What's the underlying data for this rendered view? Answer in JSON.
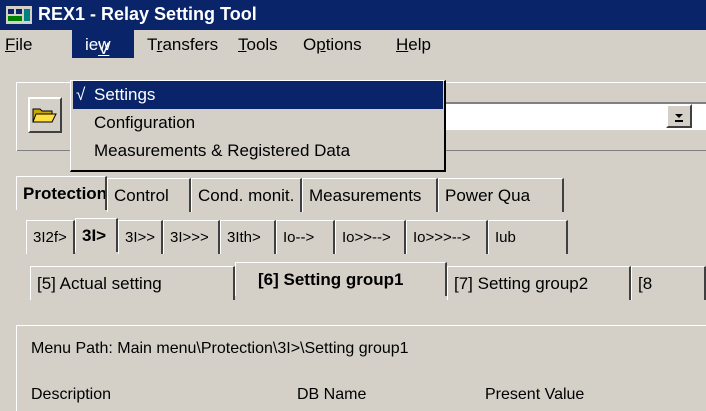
{
  "window": {
    "title": "REX1 - Relay Setting Tool"
  },
  "menubar": {
    "items": [
      "File",
      "View",
      "Transfers",
      "Tools",
      "Options",
      "Help"
    ],
    "mnemonic_index": [
      0,
      0,
      1,
      0,
      1,
      0
    ]
  },
  "view_menu": {
    "items": [
      {
        "label": "Settings",
        "checked": true,
        "check": "√"
      },
      {
        "label": "Configuration",
        "checked": false
      },
      {
        "label": "Measurements & Registered Data",
        "checked": false
      }
    ]
  },
  "toolbar": {
    "open_icon": "folder-icon",
    "combo_arrow": "chevron-down-icon"
  },
  "tabs_level1": [
    "Protection",
    "Control",
    "Cond. monit.",
    "Measurements",
    "Power Qua"
  ],
  "tabs_level2": [
    "3I2f>",
    "3I>",
    "3I>>",
    "3I>>>",
    "3Ith>",
    "Io-->",
    "Io>>-->",
    "Io>>>-->",
    "Iub"
  ],
  "tabs_level3": [
    "[5] Actual setting",
    "[6] Setting group1",
    "[7] Setting group2",
    "[8"
  ],
  "content": {
    "menu_path": "Menu Path:  Main menu\\Protection\\3I>\\Setting group1",
    "columns": [
      "Description",
      "DB Name",
      "Present Value"
    ]
  }
}
